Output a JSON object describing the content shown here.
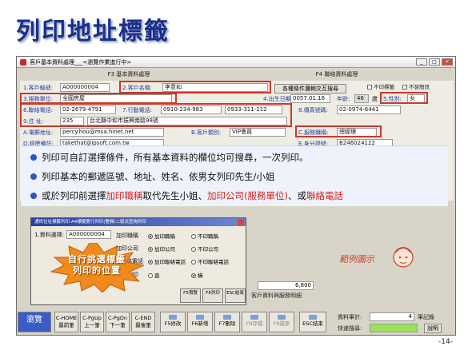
{
  "slide": {
    "title": "列印地址標籤",
    "page_number": "-14-"
  },
  "window": {
    "title": "客戶基本資料處理___<瀏覽作業進行中>",
    "tabs": [
      "F3 基本資料處理",
      "F4 聯絡資料處理"
    ],
    "controls": [
      "_",
      "□",
      "×"
    ]
  },
  "form": {
    "customer_no_label": "1.客戶編號:",
    "customer_no": "A000000004",
    "customer_name_label": "2.客戶名稱:",
    "customer_name": "李意如",
    "dob_label": "4.出生日期:",
    "dob": "0057.01.16",
    "age_label": "年齡:",
    "age": "46",
    "age_unit": "歲",
    "gender_label": "5.性別:",
    "gender": "女",
    "employer_label": "3.服務單位:",
    "employer": "全國房屋",
    "phone_label": "6.聯絡電話:",
    "phone": "02-2679-4791",
    "mobile_label": "7.行動電話:",
    "mobile": "0910-234-983",
    "mobile2": "0933-311-112",
    "fax_label": "8.傳真號碼:",
    "fax": "02-0974-6441",
    "address_label": "9.住    址:",
    "zip": "235",
    "address": "台北縣中和市振興南路98號",
    "email_label": "A.電郵地址:",
    "email": "percy.hou@msa.hinet.net",
    "category_label": "B.客戶類別:",
    "category": "VIP會員",
    "website_label": "D.經歷備註:",
    "website": "takethat@ipsoft.com.tw",
    "title_label": "C.服務職稱:",
    "title": "總經理",
    "idno_label": "E.身分證號:",
    "idno": "B246024122",
    "search_button": "各種條件邏輯交互搜尋",
    "checkbox_noprint": "不印標籤",
    "checkbox_nosend": "不發簡訊"
  },
  "bullets": [
    {
      "parts": [
        {
          "text": "列印可自訂選擇條件，所有基本資料的欄位均可搜尋，一次列印。",
          "red": false
        }
      ]
    },
    {
      "parts": [
        {
          "text": "列印基本的郵遞區號、地址、姓名、依男女列印先生/小姐",
          "red": false
        }
      ]
    },
    {
      "parts": [
        {
          "text": "或於列印前選擇",
          "red": false
        },
        {
          "text": "加印職稱",
          "red": true
        },
        {
          "text": "取代先生小姐、",
          "red": false
        },
        {
          "text": "加印公司(服務單位)",
          "red": true
        },
        {
          "text": "、或",
          "red": false
        },
        {
          "text": "聯絡電話",
          "red": true
        }
      ]
    }
  ],
  "dialog": {
    "title": "通訊住址標籤列印-A4標籤雙行列印(雙欄)二版式查詢列印",
    "field_label": "1.資料選擇:",
    "field_value": "A000000004",
    "options": [
      {
        "label": "加印職稱",
        "sel": "加印職稱",
        "alt": "不印職稱"
      },
      {
        "label": "加印公司",
        "sel": "加印公司",
        "alt": "不印公司"
      },
      {
        "label": "加印聯絡電話",
        "sel": "加印聯絡電話",
        "alt": "不印聯絡電話"
      }
    ],
    "orientation": {
      "label": "列印",
      "options": [
        "直",
        "橫"
      ]
    },
    "buttons": [
      "F5預覽",
      "F6列印",
      "ESC結束"
    ]
  },
  "burst": {
    "line1": "自行挑選標籤",
    "line2": "列印的位置"
  },
  "sample": {
    "label": "範例圖示"
  },
  "value_box": "6,800",
  "bottom_tab": "客戶資料與服務明細",
  "toolbar": {
    "buttons": [
      "瀏覽",
      "C-HOME\n最前筆",
      "C-PgUp\n上一筆",
      "C-PgDn\n下一筆",
      "C-END\n最後筆",
      "F5修改",
      "F6新增",
      "F7刪除",
      "F8存檔",
      "F9還原",
      "ESC結束"
    ],
    "record_total_label": "資料筆計:",
    "record_total": "4",
    "record_unit": "筆記錄",
    "quick_search_label": "快速搜尋:",
    "help_button": "說明"
  },
  "colors": {
    "title": "#1a2f8a",
    "highlight_box": "#c93a2a",
    "bullet_dot": "#2b55c6",
    "burst": "#f08a1c",
    "red_text": "#d81e1e"
  }
}
